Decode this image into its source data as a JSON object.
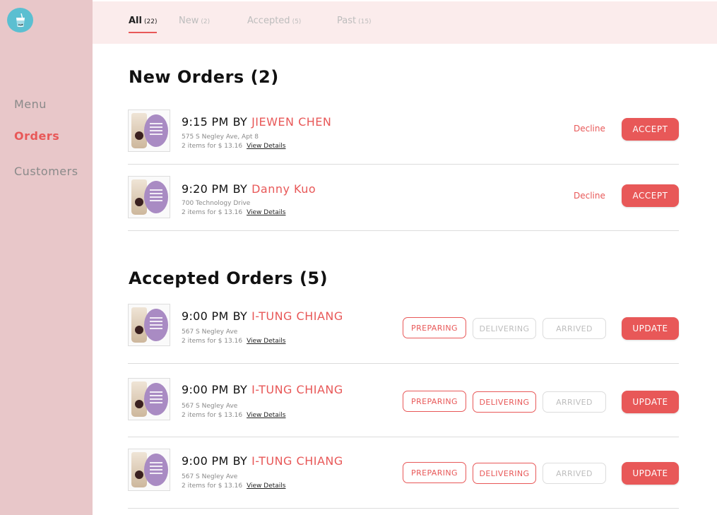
{
  "sidebar": {
    "logo": "bubble-tea-cup-icon",
    "items": [
      {
        "label": "Menu",
        "active": false
      },
      {
        "label": "Orders",
        "active": true
      },
      {
        "label": "Customers",
        "active": false
      }
    ]
  },
  "tabs": [
    {
      "label": "All",
      "count": "(22)",
      "active": true
    },
    {
      "label": "New",
      "count": "(2)",
      "active": false
    },
    {
      "label": "Accepted",
      "count": "(5)",
      "active": false
    },
    {
      "label": "Past",
      "count": "(15)",
      "active": false
    }
  ],
  "new_orders": {
    "title": "New Orders (2)",
    "decline_label": "Decline",
    "accept_label": "ACCEPT",
    "orders": [
      {
        "time": "9:15 PM",
        "by": "BY",
        "customer": "JIEWEN CHEN",
        "address": "575 S Negley Ave, Apt 8",
        "items": "2 items for $ 13.16",
        "details": "View Details"
      },
      {
        "time": "9:20 PM",
        "by": "BY",
        "customer": "Danny Kuo",
        "address": "700 Technology Drive",
        "items": "2 items for $ 13.16",
        "details": "View Details"
      }
    ]
  },
  "accepted_orders": {
    "title": "Accepted Orders (5)",
    "status_labels": [
      "PREPARING",
      "DELIVERING",
      "ARRIVED"
    ],
    "update_label": "UPDATE",
    "orders": [
      {
        "time": "9:00 PM",
        "by": "BY",
        "customer": "I-TUNG CHIANG",
        "address": "567 S Negley Ave",
        "items": "2 items for $ 13.16",
        "details": "View Details",
        "status": "PREPARING"
      },
      {
        "time": "9:00 PM",
        "by": "BY",
        "customer": "I-TUNG CHIANG",
        "address": "567 S Negley Ave",
        "items": "2 items for $ 13.16",
        "details": "View Details",
        "status": "DELIVERING"
      },
      {
        "time": "9:00 PM",
        "by": "BY",
        "customer": "I-TUNG CHIANG",
        "address": "567 S Negley Ave",
        "items": "2 items for $ 13.16",
        "details": "View Details",
        "status": "DELIVERING"
      }
    ]
  },
  "colors": {
    "accent": "#e85858",
    "sidebar": "#e8c7c9",
    "tabs_bar": "#fbecec",
    "logo": "#5bbfd1"
  }
}
